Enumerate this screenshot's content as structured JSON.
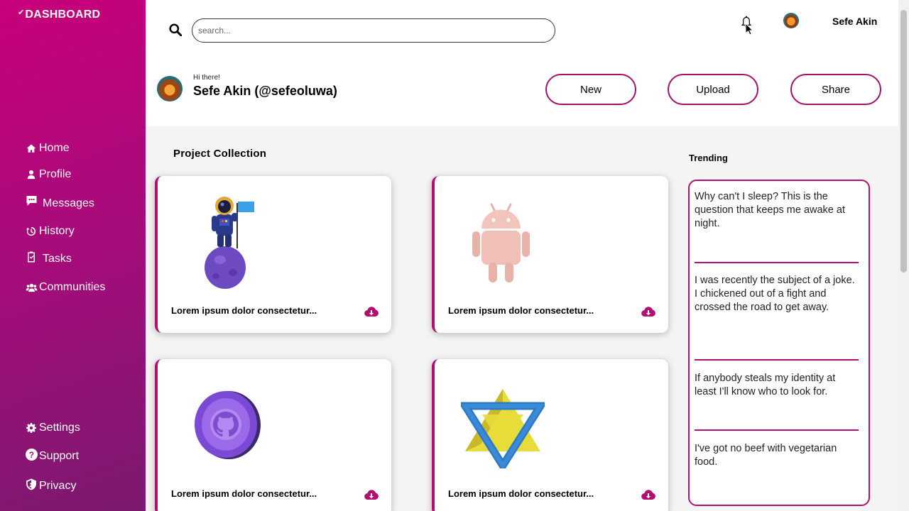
{
  "sidebar": {
    "brand": "DASHBOARD",
    "nav": [
      {
        "label": "Home",
        "icon": "home-icon"
      },
      {
        "label": "Profile",
        "icon": "user-icon"
      },
      {
        "label": "Messages",
        "icon": "message-icon"
      },
      {
        "label": "History",
        "icon": "history-icon"
      },
      {
        "label": "Tasks",
        "icon": "clipboard-check-icon"
      },
      {
        "label": "Communities",
        "icon": "users-icon"
      }
    ],
    "bottom_nav": [
      {
        "label": "Settings",
        "icon": "gear-icon"
      },
      {
        "label": "Support",
        "icon": "question-circle-icon"
      },
      {
        "label": "Privacy",
        "icon": "shield-icon"
      }
    ],
    "colors": {
      "gradient_start": "#c8007a",
      "gradient_end": "#7a1a6e"
    }
  },
  "header": {
    "search_placeholder": "search...",
    "username": "Sefe Akin",
    "greeting": "Hi there!",
    "profile_name": "Sefe Akin (@sefeoluwa)",
    "buttons": {
      "new": "New",
      "upload": "Upload",
      "share": "Share"
    }
  },
  "projects": {
    "title": "Project Collection",
    "cards": [
      {
        "caption": "Lorem ipsum dolor consectetur...",
        "art": "astronaut-on-moon"
      },
      {
        "caption": "Lorem ipsum dolor consectetur...",
        "art": "android-robot"
      },
      {
        "caption": "Lorem ipsum dolor consectetur...",
        "art": "github-coin"
      },
      {
        "caption": "Lorem ipsum dolor consectetur...",
        "art": "star-of-david"
      }
    ]
  },
  "trending": {
    "title": "Trending",
    "items": [
      "Why can't I sleep? This is the question that keeps me awake at night.",
      "I was recently the subject of a joke. I chickened out of a fight and crossed the road to get away.",
      "If anybody steals my identity at least I'll know who to look for.",
      "I've got no beef with vegetarian food."
    ]
  },
  "theme": {
    "accent": "#b0106f"
  }
}
